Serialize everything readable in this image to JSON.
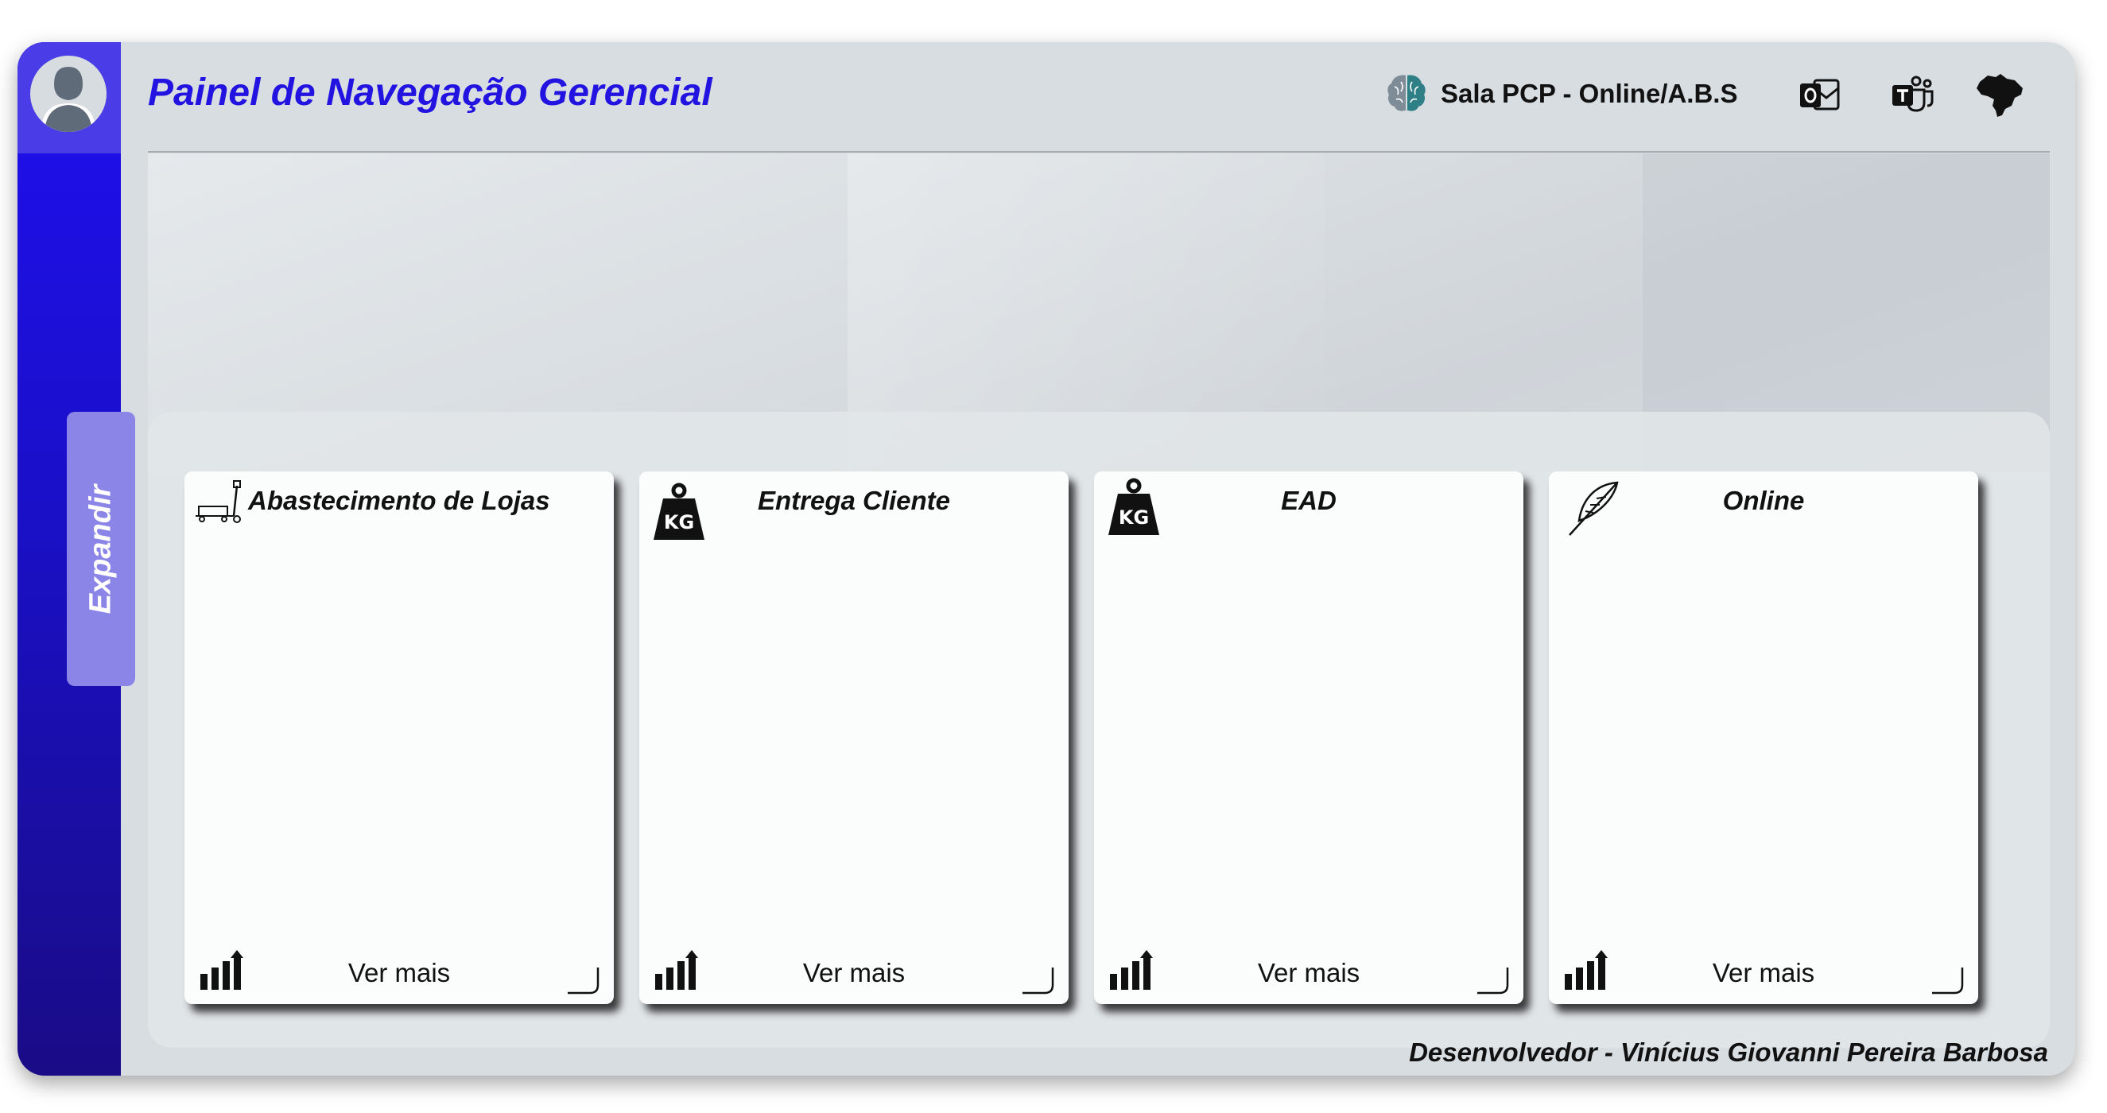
{
  "header": {
    "title": "Painel de Navegação Gerencial",
    "room_label": "Sala PCP - Online/A.B.S",
    "icons": [
      "brain-icon",
      "outlook-icon",
      "teams-icon",
      "brazil-map-icon"
    ]
  },
  "sidebar": {
    "expand_label": "Expandir",
    "avatar_icon": "user-avatar-icon"
  },
  "cards": [
    {
      "title": "Abastecimento de Lojas",
      "icon": "pallet-jack-icon",
      "see_more": "Ver mais"
    },
    {
      "title": "Entrega Cliente",
      "icon": "kg-weight-icon",
      "see_more": "Ver mais"
    },
    {
      "title": "EAD",
      "icon": "kg-weight-icon",
      "see_more": "Ver mais"
    },
    {
      "title": "Online",
      "icon": "feather-icon",
      "see_more": "Ver mais"
    }
  ],
  "footer": {
    "developer": "Desenvolvedor - Vinícius Giovanni Pereira Barbosa"
  },
  "colors": {
    "sidebar_top": "#1f0ff0",
    "sidebar_bottom": "#1a0c86",
    "title": "#2213e0",
    "background": "#d8dde1",
    "card": "#fbfcfc"
  }
}
